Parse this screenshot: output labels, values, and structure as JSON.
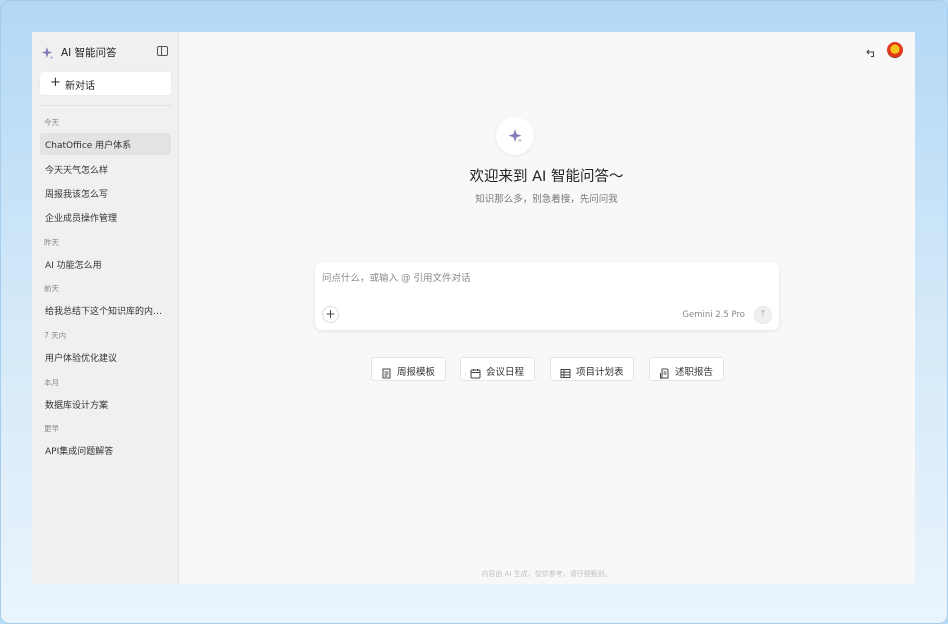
{
  "sidebar": {
    "title": "AI 智能问答",
    "new_chat_label": "新对话",
    "groups": [
      {
        "label": "今天",
        "items": [
          "ChatOffice 用户体系",
          "今天天气怎么样",
          "周报我该怎么写",
          "企业成员操作管理"
        ]
      },
      {
        "label": "昨天",
        "items": [
          "AI 功能怎么用"
        ]
      },
      {
        "label": "前天",
        "items": [
          "给我总结下这个知识库的内容..."
        ]
      },
      {
        "label": "7 天内",
        "items": [
          "用户体验优化建议"
        ]
      },
      {
        "label": "本月",
        "items": [
          "数据库设计方案"
        ]
      },
      {
        "label": "更早",
        "items": [
          "API集成问题解答"
        ]
      }
    ],
    "active_item": "ChatOffice 用户体系"
  },
  "main": {
    "welcome_title": "欢迎来到 AI 智能问答～",
    "welcome_subtitle": "知识那么多，别急着搜，先问问我",
    "input_placeholder": "问点什么，或输入 @ 引用文件对话",
    "model_label": "Gemini 2.5 Pro",
    "quick_actions": [
      {
        "label": "周报模板",
        "icon": "document-icon"
      },
      {
        "label": "会议日程",
        "icon": "calendar-icon"
      },
      {
        "label": "项目计划表",
        "icon": "table-icon"
      },
      {
        "label": "述职报告",
        "icon": "report-icon"
      }
    ],
    "footer_note": "内容由 AI 生成，仅供参考，请仔细甄别。"
  },
  "colors": {
    "accent": "#8a7bb8",
    "sidebar_bg": "#f0f0f0",
    "main_bg": "#f8f8f8",
    "frame_bg": "#b8dcf6"
  }
}
